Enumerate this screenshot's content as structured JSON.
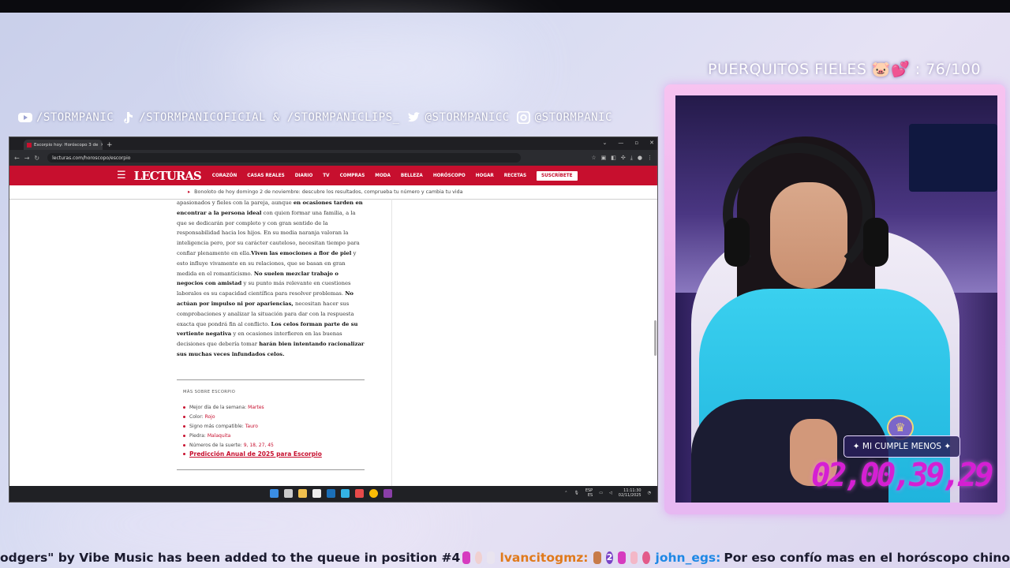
{
  "socials": [
    {
      "icon": "youtube-icon",
      "label": "/STORMPANIC"
    },
    {
      "icon": "tiktok-icon",
      "label": "/STORMPANICOFICIAL & /STORMPANICLIPS_"
    },
    {
      "icon": "twitter-icon",
      "label": "@STORMPANICC"
    },
    {
      "icon": "instagram-icon",
      "label": "@STORMPANIC"
    }
  ],
  "fieles": {
    "label": "PUERQUITOS FIELES 🐷💕 : 76/100"
  },
  "browser": {
    "tab_title": "Escorpio hoy: Horóscopo 3 de",
    "url": "lecturas.com/horoscopo/escorpio",
    "logo": "LECTURAS",
    "nav": [
      "CORAZÓN",
      "CASAS REALES",
      "DIARIO",
      "TV",
      "COMPRAS",
      "MODA",
      "BELLEZA",
      "HORÓSCOPO",
      "HOGAR",
      "RECETAS"
    ],
    "subscribe": "SUSCRÍBETE",
    "promo": "Bonoloto de hoy domingo 2 de noviembre: descubre los resultados, comprueba tu número y cambia tu vida"
  },
  "article": {
    "p1": "apasionados y fieles con la pareja, aunque ",
    "b1": "en ocasiones tarden en encontrar a la persona ideal",
    "p2": " con quien formar una familia, a la que se dedicarán por completo y con gran sentido de la responsabilidad hacia los hijos. En su media naranja valoran la inteligencia pero, por su carácter cauteloso, necesitan tiempo para confiar plenamente en ella.",
    "b2": "Viven las emociones a flor de piel",
    "p3": " y esto influye vivamente en su relaciones, que se basan en gran medida en el romanticismo. ",
    "b3": "No suelen mezclar trabajo o negocios con amistad",
    "p4": " y su punto más relevante en cuestiones laborales es su capacidad científica para resolver problemas. ",
    "b4": "No actúan por impulso ni por apariencias,",
    "p5": " necesitan hacer sus comprobaciones y analizar la situación para dar con la respuesta exacta que pondrá fin al conflicto. ",
    "b5": "Los celos forman parte de su vertiente negativa",
    "p6": " y en ocasiones interfieren en las buenas decisiones que debería tomar ",
    "b6": "harán bien intentando racionalizar sus muchas veces infundados celos."
  },
  "mas": {
    "title": "MÁS SOBRE ESCORPIO",
    "facts": [
      {
        "label": "Mejor día de la semana:",
        "value": "Martes"
      },
      {
        "label": "Color:",
        "value": "Rojo"
      },
      {
        "label": "Signo más compatible:",
        "value": "Tauro"
      },
      {
        "label": "Piedra:",
        "value": "Malaquita"
      },
      {
        "label": "Números de la suerte:",
        "value": "9, 18, 27, 45"
      }
    ],
    "prediction": "Predicción Anual de 2025 para Escorpio"
  },
  "taskbar": {
    "lang1": "ESP",
    "lang2": "ES",
    "time": "11:11:30",
    "date": "02/11/2025"
  },
  "overlay": {
    "badge": "✦ MI CUMPLE MENOS ✦",
    "timer": "02,00,39,29"
  },
  "ticker": {
    "msg1": "odgers\" by Vibe Music has been added to the queue in position #4",
    "user1": "lvancitogmz:",
    "count": "2",
    "user2": "john_egs:",
    "msg2": "Por eso confío mas en el horóscopo chino"
  },
  "colors": {
    "brand": "#c70f2e",
    "timer": "#d51fd3",
    "frame": "#eab2ee"
  }
}
